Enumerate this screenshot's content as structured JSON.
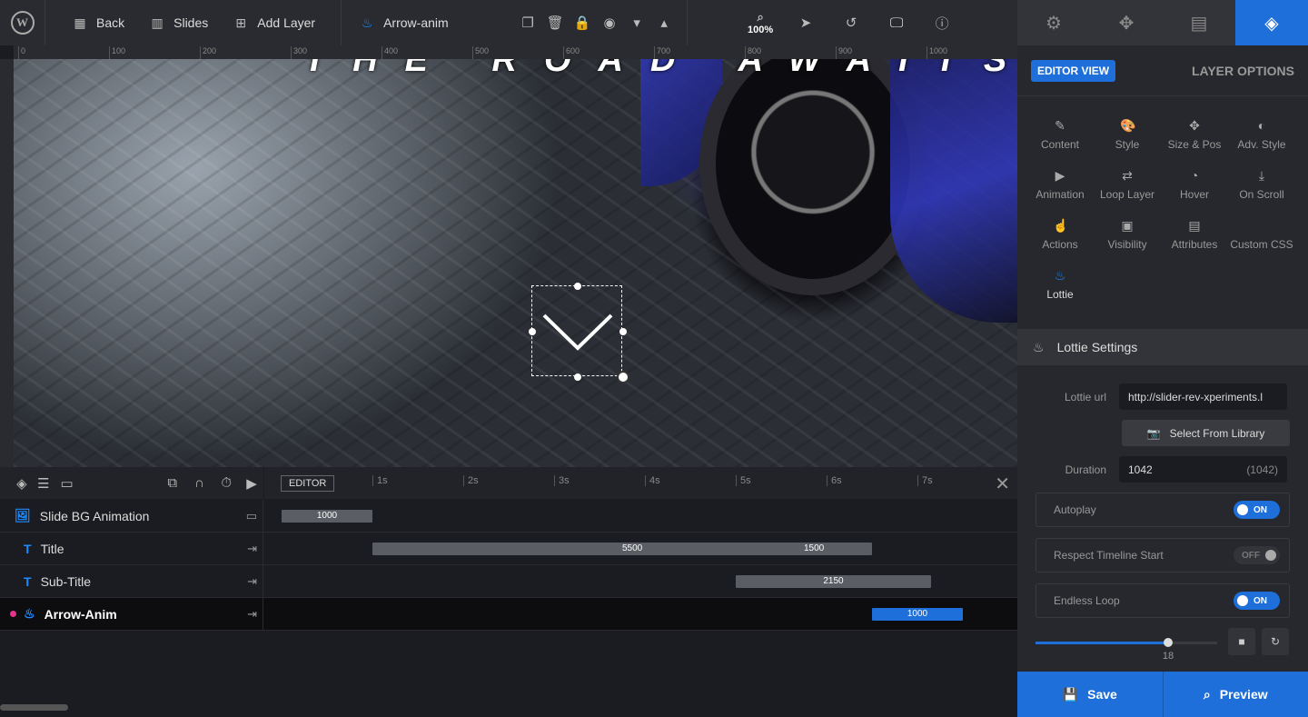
{
  "toolbar": {
    "back": "Back",
    "slides": "Slides",
    "add_layer": "Add Layer",
    "layer_name": "Arrow-anim",
    "zoom": "100%"
  },
  "panel": {
    "editor_view": "EDITOR VIEW",
    "layer_options": "LAYER OPTIONS",
    "options": [
      "Content",
      "Style",
      "Size & Pos",
      "Adv. Style",
      "Animation",
      "Loop Layer",
      "Hover",
      "On Scroll",
      "Actions",
      "Visibility",
      "Attributes",
      "Custom CSS",
      "Lottie"
    ],
    "section": "Lottie Settings",
    "lottie_url_label": "Lottie url",
    "lottie_url": "http://slider-rev-xperiments.l",
    "select_library": "Select From Library",
    "duration_label": "Duration",
    "duration": "1042",
    "duration_hint": "(1042)",
    "autoplay": "Autoplay",
    "autoplay_state": "ON",
    "respect": "Respect Timeline Start",
    "respect_state": "OFF",
    "loop": "Endless Loop",
    "loop_state": "ON",
    "slider_value": "18",
    "slider_fraction": 0.73,
    "save": "Save",
    "preview": "Preview"
  },
  "canvas": {
    "headline": "THE ROAD AWAITS",
    "ruler_ticks": [
      "0",
      "100",
      "200",
      "300",
      "400",
      "500",
      "600",
      "700",
      "800",
      "900",
      "1000"
    ]
  },
  "timeline": {
    "editor": "EDITOR",
    "seconds": [
      "1s",
      "2s",
      "3s",
      "4s",
      "5s",
      "6s",
      "7s"
    ],
    "rows": [
      {
        "name": "Slide BG Animation",
        "bars": [
          "1000"
        ]
      },
      {
        "name": "Title",
        "bars": [
          "5500",
          "1500"
        ]
      },
      {
        "name": "Sub-Title",
        "bars": [
          "2150"
        ]
      },
      {
        "name": "Arrow-Anim",
        "bars": [
          "1000"
        ]
      }
    ]
  },
  "colors": {
    "accent": "#1e6fd9",
    "bg": "#1b1c21"
  }
}
